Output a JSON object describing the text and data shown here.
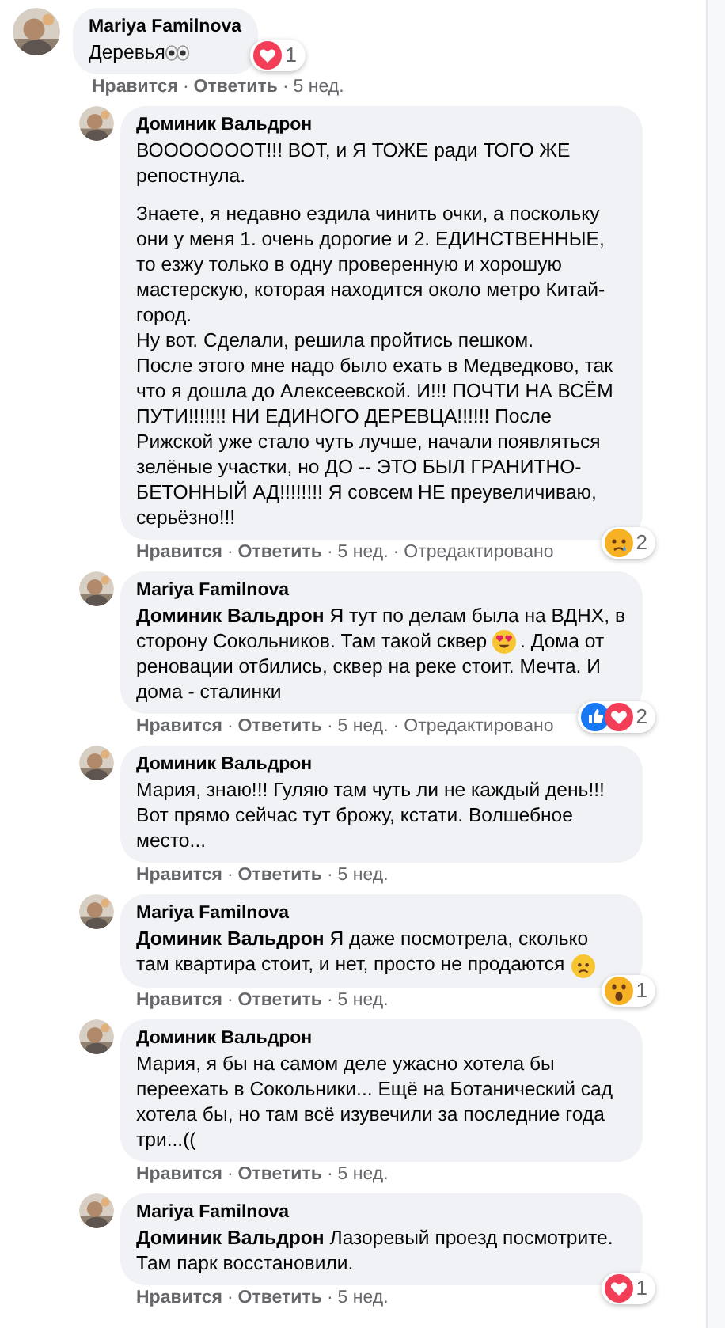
{
  "separator": "·",
  "comments": [
    {
      "author": "Mariya Familnova",
      "avatar": {
        "kind": "picture"
      },
      "body": [
        {
          "lines": [
            [
              {
                "kind": "text",
                "text": "Деревья"
              },
              {
                "kind": "eyes"
              }
            ]
          ]
        }
      ],
      "reaction": {
        "icons": [
          {
            "kind": "heart"
          }
        ],
        "count": "1"
      },
      "like": "Нравится",
      "reply": "Ответить",
      "time": "5 нед.",
      "children": [
        {
          "author": "Доминик Вальдрон",
          "avatar": {
            "kind": "picture"
          },
          "body": [
            {
              "lines": [
                [
                  {
                    "kind": "text",
                    "text": "ВОООООООТ!!! ВОТ, и Я ТОЖЕ ради ТОГО ЖЕ репостнула."
                  }
                ]
              ]
            },
            {
              "lines": [
                [
                  {
                    "kind": "text",
                    "text": "Знаете, я недавно ездила чинить очки, а поскольку они у меня 1. очень дорогие и 2. ЕДИНСТВЕННЫЕ, то езжу только в одну проверенную и хорошую мастерскую, которая находится около метро Китай-город.\nНу вот. Сделали, решила пройтись пешком.\nПосле этого мне надо было ехать в Медведково, так что я дошла до Алексеевской. И!!! ПОЧТИ НА ВСЁМ ПУТИ!!!!!!! НИ ЕДИНОГО ДЕРЕВЦА!!!!!! После Рижской уже стало чуть лучше, начали появляться зелёные участки, но ДО -- ЭТО БЫЛ ГРАНИТНО-БЕТОННЫЙ АД!!!!!!!! Я совсем НЕ преувеличиваю, серьёзно!!!"
                  }
                ]
              ]
            }
          ],
          "reaction": {
            "icons": [
              {
                "kind": "sad"
              }
            ],
            "count": "2"
          },
          "like": "Нравится",
          "reply": "Ответить",
          "time": "5 нед.",
          "edited": "Отредактировано"
        },
        {
          "author": "Mariya Familnova",
          "avatar": {
            "kind": "picture"
          },
          "body": [
            {
              "lines": [
                [
                  {
                    "kind": "text",
                    "text": "**Доминик Вальдрон** Я тут по делам была на ВДНХ, в"
                  }
                ],
                [
                  {
                    "kind": "text",
                    "text": "сторону Сокольников. Там такой сквер"
                  },
                  {
                    "kind": "heart-eyes"
                  },
                  {
                    "kind": "text",
                    "text": ". Дома от"
                  }
                ],
                [
                  {
                    "kind": "text",
                    "text": "реновации отбились, сквер на реке стоит. Мечта. И дома - сталинки"
                  }
                ]
              ]
            }
          ],
          "reaction": {
            "icons": [
              {
                "kind": "like"
              },
              {
                "kind": "heart"
              }
            ],
            "count": "2"
          },
          "like": "Нравится",
          "reply": "Ответить",
          "time": "5 нед.",
          "edited": "Отредактировано"
        },
        {
          "author": "Доминик Вальдрон",
          "avatar": {
            "kind": "picture"
          },
          "body": [
            {
              "lines": [
                [
                  {
                    "kind": "text",
                    "text": "Мария, знаю!!! Гуляю там чуть ли не каждый день!!! Вот прямо сейчас тут брожу, кстати. Волшебное место..."
                  }
                ]
              ]
            }
          ],
          "like": "Нравится",
          "reply": "Ответить",
          "time": "5 нед."
        },
        {
          "author": "Mariya Familnova",
          "avatar": {
            "kind": "picture"
          },
          "body": [
            {
              "lines": [
                [
                  {
                    "kind": "text",
                    "text": "**Доминик Вальдрон** Я даже посмотрела, сколько"
                  }
                ],
                [
                  {
                    "kind": "text",
                    "text": "там квартира стоит, и нет, просто не продаются"
                  },
                  {
                    "kind": "sad"
                  }
                ]
              ]
            }
          ],
          "reaction": {
            "icons": [
              {
                "kind": "wow"
              }
            ],
            "count": "1"
          },
          "like": "Нравится",
          "reply": "Ответить",
          "time": "5 нед."
        },
        {
          "author": "Доминик Вальдрон",
          "avatar": {
            "kind": "picture"
          },
          "body": [
            {
              "lines": [
                [
                  {
                    "kind": "text",
                    "text": "Мария, я бы на самом деле ужасно хотела бы переехать в Сокольники... Ещё на Ботанический сад хотела бы, но там всё изувечили за последние года три...(("
                  }
                ]
              ]
            }
          ],
          "like": "Нравится",
          "reply": "Ответить",
          "time": "5 нед."
        },
        {
          "author": "Mariya Familnova",
          "avatar": {
            "kind": "picture"
          },
          "body": [
            {
              "lines": [
                [
                  {
                    "kind": "text",
                    "text": "**Доминик Вальдрон** Лазоревый проезд посмотрите. Там парк восстановили."
                  }
                ]
              ]
            }
          ],
          "reaction": {
            "icons": [
              {
                "kind": "heart"
              }
            ],
            "count": "1"
          },
          "like": "Нравится",
          "reply": "Ответить",
          "time": "5 нед."
        }
      ]
    }
  ]
}
